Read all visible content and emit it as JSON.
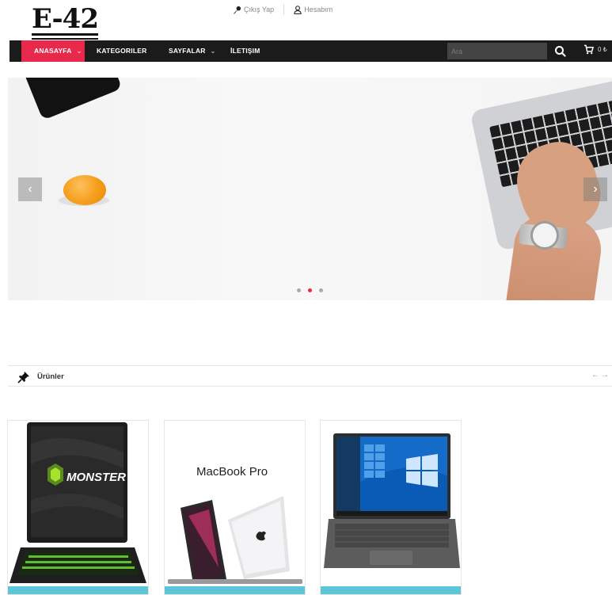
{
  "brand": {
    "logo_text": "E-42"
  },
  "toplinks": {
    "logout": "Çıkış Yap",
    "account": "Hesabım"
  },
  "nav": {
    "items": [
      {
        "label": "ANASAYFA",
        "active": true,
        "has_dropdown": true
      },
      {
        "label": "KATEGORILER",
        "active": false,
        "has_dropdown": false
      },
      {
        "label": "SAYFALAR",
        "active": false,
        "has_dropdown": true
      },
      {
        "label": "İLETIŞIM",
        "active": false,
        "has_dropdown": false
      }
    ],
    "search_placeholder": "Ara",
    "cart_count": "0 ₺"
  },
  "slider": {
    "slide_count": 3,
    "active_index": 1,
    "prev_icon": "chevron-left-icon",
    "next_icon": "chevron-right-icon"
  },
  "products": {
    "title": "Ürünler",
    "arrows": "←→",
    "cards": [
      {
        "image_text": "MONSTER",
        "image_kind": "gaming-laptop"
      },
      {
        "image_text": "MacBook Pro",
        "image_kind": "macbook"
      },
      {
        "image_text": "",
        "image_kind": "windows-laptop"
      }
    ]
  },
  "colors": {
    "accent": "#e8294c",
    "nav_bg": "#1b1b1b",
    "card_footer": "#5ec5d6"
  }
}
